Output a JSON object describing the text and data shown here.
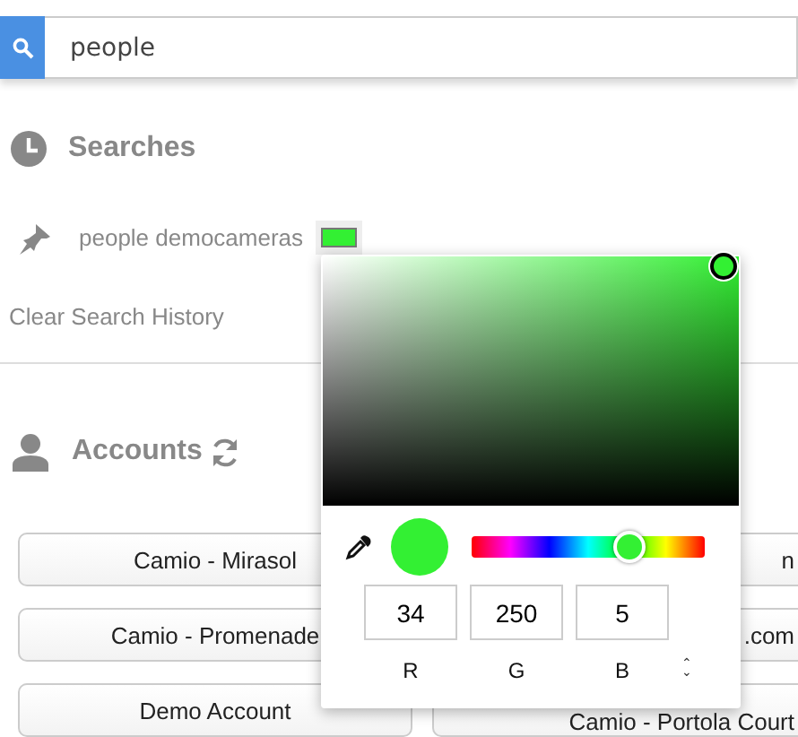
{
  "search": {
    "value": "people"
  },
  "searches": {
    "title": "Searches",
    "pinned": [
      {
        "label": "people democameras",
        "color": "#33f033"
      }
    ],
    "clear_label": "Clear Search History"
  },
  "accounts": {
    "title": "Accounts",
    "buttons": [
      {
        "label": "Camio - Mirasol"
      },
      {
        "label": "n"
      },
      {
        "label": "Camio - Promenade"
      },
      {
        "label": ".com"
      },
      {
        "label": "Demo Account"
      },
      {
        "label": "Camio - Portola Court"
      }
    ]
  },
  "color_picker": {
    "color": "#33f033",
    "hue": {
      "level": 0.68
    },
    "channels": [
      {
        "value": "34",
        "label": "R"
      },
      {
        "value": "250",
        "label": "G"
      },
      {
        "value": "5",
        "label": "B"
      }
    ],
    "mode_toggle": "⌃⌄"
  }
}
